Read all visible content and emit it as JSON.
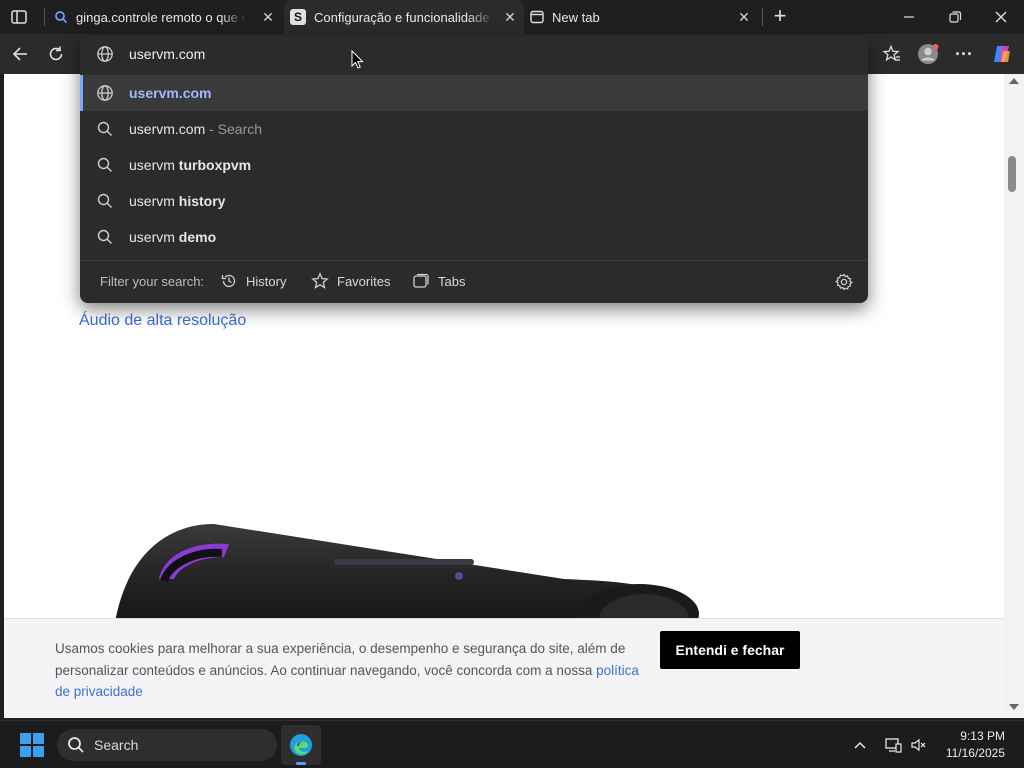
{
  "tabs": [
    {
      "title": "ginga.controle remoto o que e - S",
      "icon": "search-favicon"
    },
    {
      "title": "Configuração e funcionalidade de",
      "icon": "s-favicon",
      "active": true
    },
    {
      "title": "New tab",
      "icon": "newtab-favicon"
    }
  ],
  "omnibox": {
    "input_value": "uservm.com",
    "suggestions": [
      {
        "prefix": "uservm.com",
        "suffix": "",
        "icon": "globe-icon",
        "selected": true
      },
      {
        "prefix": "uservm.com",
        "suffix": " - Search",
        "icon": "search-icon"
      },
      {
        "prefix": "uservm ",
        "suffix": "turboxpvm",
        "icon": "search-icon"
      },
      {
        "prefix": "uservm ",
        "suffix": "history",
        "icon": "search-icon"
      },
      {
        "prefix": "uservm ",
        "suffix": "demo",
        "icon": "search-icon"
      }
    ],
    "filter_label": "Filter your search:",
    "filters": [
      "History",
      "Favorites",
      "Tabs"
    ]
  },
  "page": {
    "link_text": "Áudio de alta resolução"
  },
  "cookie": {
    "text": "Usamos cookies para melhorar a sua experiência, o desempenho e segurança do site, além de personalizar conteúdos e anúncios. Ao continuar navegando, você concorda com a nossa ",
    "link": "política de privacidade",
    "button": "Entendi e fechar"
  },
  "taskbar": {
    "search_label": "Search",
    "time": "9:13 PM",
    "date": "11/16/2025"
  },
  "colors": {
    "link_blue": "#3b6fd6",
    "accent": "#7aa7ff"
  }
}
